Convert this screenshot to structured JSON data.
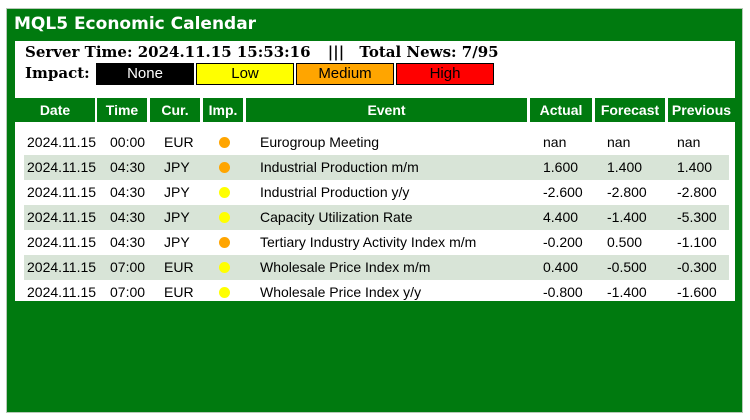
{
  "window": {
    "title": "MQL5 Economic Calendar"
  },
  "info": {
    "server_time": "Server Time: 2024.11.15 15:53:16",
    "separator": "|||",
    "total_news": "Total News: 7/95"
  },
  "impact": {
    "label": "Impact:",
    "buttons": [
      {
        "label": "None",
        "bg": "#000000",
        "fg": "#ffffff"
      },
      {
        "label": "Low",
        "bg": "#ffff00",
        "fg": "#000000"
      },
      {
        "label": "Medium",
        "bg": "#ffa500",
        "fg": "#000000"
      },
      {
        "label": "High",
        "bg": "#ff0000",
        "fg": "#000000"
      }
    ]
  },
  "colors": {
    "low": "#ffff00",
    "medium": "#ffa500",
    "header": "#007a0f",
    "alt_row": "#d8e4d7"
  },
  "table": {
    "headers": [
      "Date",
      "Time",
      "Cur.",
      "Imp.",
      "Event",
      "Actual",
      "Forecast",
      "Previous"
    ],
    "rows": [
      {
        "date": "2024.11.15",
        "time": "00:00",
        "cur": "EUR",
        "impact": "medium",
        "event": "Eurogroup Meeting",
        "actual": "nan",
        "forecast": "nan",
        "previous": "nan"
      },
      {
        "date": "2024.11.15",
        "time": "04:30",
        "cur": "JPY",
        "impact": "medium",
        "event": "Industrial Production m/m",
        "actual": "1.600",
        "forecast": "1.400",
        "previous": "1.400"
      },
      {
        "date": "2024.11.15",
        "time": "04:30",
        "cur": "JPY",
        "impact": "low",
        "event": "Industrial Production y/y",
        "actual": "-2.600",
        "forecast": "-2.800",
        "previous": "-2.800"
      },
      {
        "date": "2024.11.15",
        "time": "04:30",
        "cur": "JPY",
        "impact": "low",
        "event": "Capacity Utilization Rate",
        "actual": "4.400",
        "forecast": "-1.400",
        "previous": "-5.300"
      },
      {
        "date": "2024.11.15",
        "time": "04:30",
        "cur": "JPY",
        "impact": "medium",
        "event": "Tertiary Industry Activity Index m/m",
        "actual": "-0.200",
        "forecast": "0.500",
        "previous": "-1.100"
      },
      {
        "date": "2024.11.15",
        "time": "07:00",
        "cur": "EUR",
        "impact": "low",
        "event": "Wholesale Price Index m/m",
        "actual": "0.400",
        "forecast": "-0.500",
        "previous": "-0.300"
      },
      {
        "date": "2024.11.15",
        "time": "07:00",
        "cur": "EUR",
        "impact": "low",
        "event": "Wholesale Price Index y/y",
        "actual": "-0.800",
        "forecast": "-1.400",
        "previous": "-1.600"
      }
    ]
  }
}
